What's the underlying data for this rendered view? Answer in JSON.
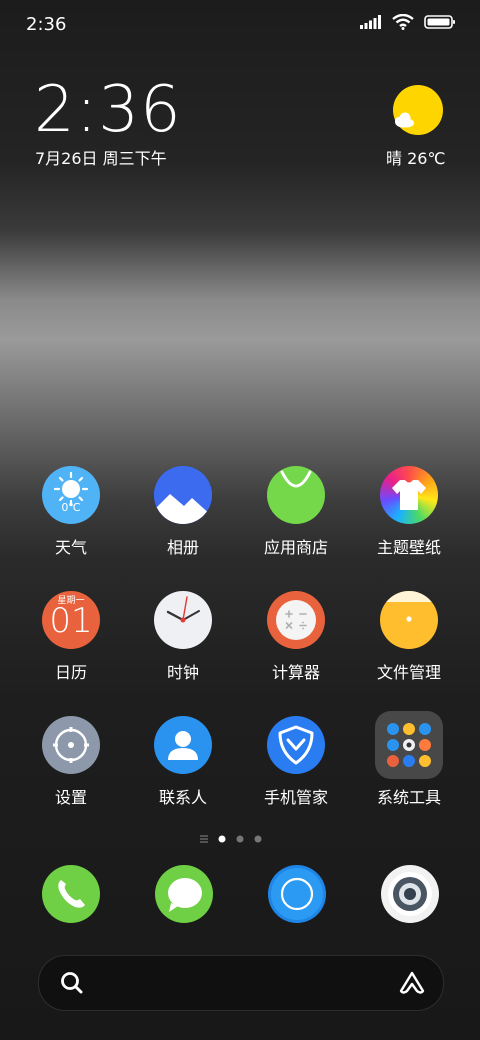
{
  "status_bar": {
    "time": "2:36",
    "icons": [
      "signal-icon",
      "wifi-icon",
      "battery-icon"
    ]
  },
  "clock_widget": {
    "time": "2:36",
    "date": "7月26日 周三下午"
  },
  "weather_widget": {
    "text": "晴 26℃",
    "icon": "sunny-cloud-icon"
  },
  "apps": [
    {
      "label": "天气",
      "icon": "weather-icon",
      "badge_text": "0℃"
    },
    {
      "label": "相册",
      "icon": "gallery-icon"
    },
    {
      "label": "应用商店",
      "icon": "app-store-icon"
    },
    {
      "label": "主题壁纸",
      "icon": "themes-icon"
    },
    {
      "label": "日历",
      "icon": "calendar-icon",
      "day_name": "星期一",
      "day_num": "01"
    },
    {
      "label": "时钟",
      "icon": "clock-icon"
    },
    {
      "label": "计算器",
      "icon": "calculator-icon"
    },
    {
      "label": "文件管理",
      "icon": "file-manager-icon"
    },
    {
      "label": "设置",
      "icon": "settings-icon"
    },
    {
      "label": "联系人",
      "icon": "contacts-icon"
    },
    {
      "label": "手机管家",
      "icon": "security-icon"
    },
    {
      "label": "系统工具",
      "icon": "system-tools-folder-icon"
    }
  ],
  "page_indicator": {
    "pages": 3,
    "current": 1
  },
  "dock": [
    {
      "icon": "phone-icon"
    },
    {
      "icon": "messages-icon"
    },
    {
      "icon": "browser-icon"
    },
    {
      "icon": "camera-icon"
    }
  ],
  "search_bar": {
    "left_icon": "search-icon",
    "right_icon": "assistant-icon"
  },
  "colors": {
    "weather_sun": "#ffd500",
    "accent_blue": "#2196f3"
  }
}
